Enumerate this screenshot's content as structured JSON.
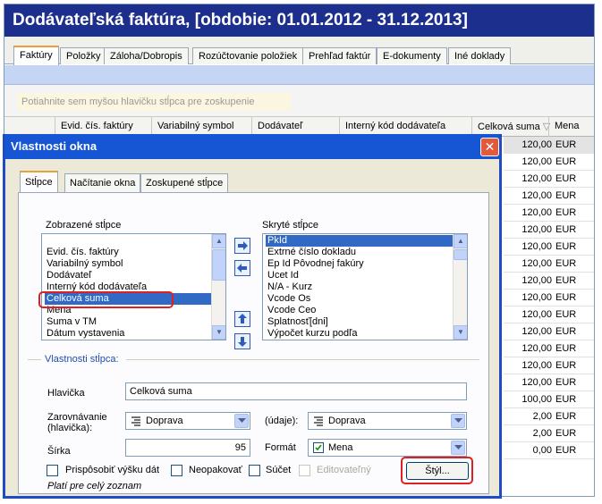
{
  "app": {
    "title": "Dodávateľská faktúra, [obdobie: 01.01.2012 - 31.12.2013]",
    "tabs": [
      "Faktúry",
      "Položky",
      "Záloha/Dobropis",
      "Rozúčtovanie položiek",
      "Prehľad faktúr",
      "E-dokumenty",
      "Iné doklady"
    ],
    "group_hint": "Potiahnite sem myšou hlavičku stĺpca pre zoskupenie",
    "columns": [
      "Evid. čís. faktúry",
      "Variabilný symbol",
      "Dodávateľ",
      "Interný kód dodávateľa",
      "Celková suma",
      "Mena"
    ],
    "rows": [
      {
        "amount": "120,00",
        "currency": "EUR"
      },
      {
        "amount": "120,00",
        "currency": "EUR"
      },
      {
        "amount": "120,00",
        "currency": "EUR"
      },
      {
        "amount": "120,00",
        "currency": "EUR"
      },
      {
        "amount": "120,00",
        "currency": "EUR"
      },
      {
        "amount": "120,00",
        "currency": "EUR"
      },
      {
        "amount": "120,00",
        "currency": "EUR"
      },
      {
        "amount": "120,00",
        "currency": "EUR"
      },
      {
        "amount": "120,00",
        "currency": "EUR"
      },
      {
        "amount": "120,00",
        "currency": "EUR"
      },
      {
        "amount": "120,00",
        "currency": "EUR"
      },
      {
        "amount": "120,00",
        "currency": "EUR"
      },
      {
        "amount": "120,00",
        "currency": "EUR"
      },
      {
        "amount": "120,00",
        "currency": "EUR"
      },
      {
        "amount": "120,00",
        "currency": "EUR"
      },
      {
        "amount": "100,00",
        "currency": "EUR"
      },
      {
        "amount": "2,00",
        "currency": "EUR"
      },
      {
        "amount": "2,00",
        "currency": "EUR"
      },
      {
        "amount": "0,00",
        "currency": "EUR"
      }
    ]
  },
  "dialog": {
    "title": "Vlastnosti okna",
    "close_glyph": "✕",
    "tabs": [
      "Stĺpce",
      "Načítanie okna",
      "Zoskupené stĺpce"
    ],
    "shown_label": "Zobrazené stĺpce",
    "hidden_label": "Skryté stĺpce",
    "shown_items": [
      "Evid. čís. faktúry",
      "Variabilný symbol",
      "Dodávateľ",
      "Interný kód dodávateľa",
      "Celková suma",
      "Mena",
      "Suma v TM",
      "Dátum vystavenia"
    ],
    "shown_selected": "Celková suma",
    "hidden_items": [
      "PkId",
      "Extrné číslo dokladu",
      "Ep Id Pôvodnej fakúry",
      "Ucet Id",
      "N/A - Kurz",
      "Vcode Os",
      "Vcode Ceo",
      "Splatnosť[dni]",
      "Výpočet kurzu podľa"
    ],
    "hidden_selected": "PkId",
    "section_label": "Vlastnosti stĺpca:",
    "header_label": "Hlavička",
    "header_value": "Celková suma",
    "align_label_1": "Zarovnávanie",
    "align_label_2": "(hlavička):",
    "align_value": "Doprava",
    "data_label": "(údaje):",
    "data_value": "Doprava",
    "width_label": "Šírka",
    "width_value": "95",
    "format_label": "Formát",
    "format_value": "Mena",
    "check_fit": "Prispôsobiť výšku dát",
    "check_norepeat": "Neopakovať",
    "check_sum": "Súčet",
    "check_editable": "Editovateľný",
    "style_button": "Štýl...",
    "footer_note": "Platí pre celý zoznam"
  },
  "colors": {
    "title_bar": "#1c2f8c",
    "dialog_title": "#1656d4",
    "selection": "#316ac5",
    "highlight": "#e02020",
    "tab_accent": "#e8a13a"
  }
}
